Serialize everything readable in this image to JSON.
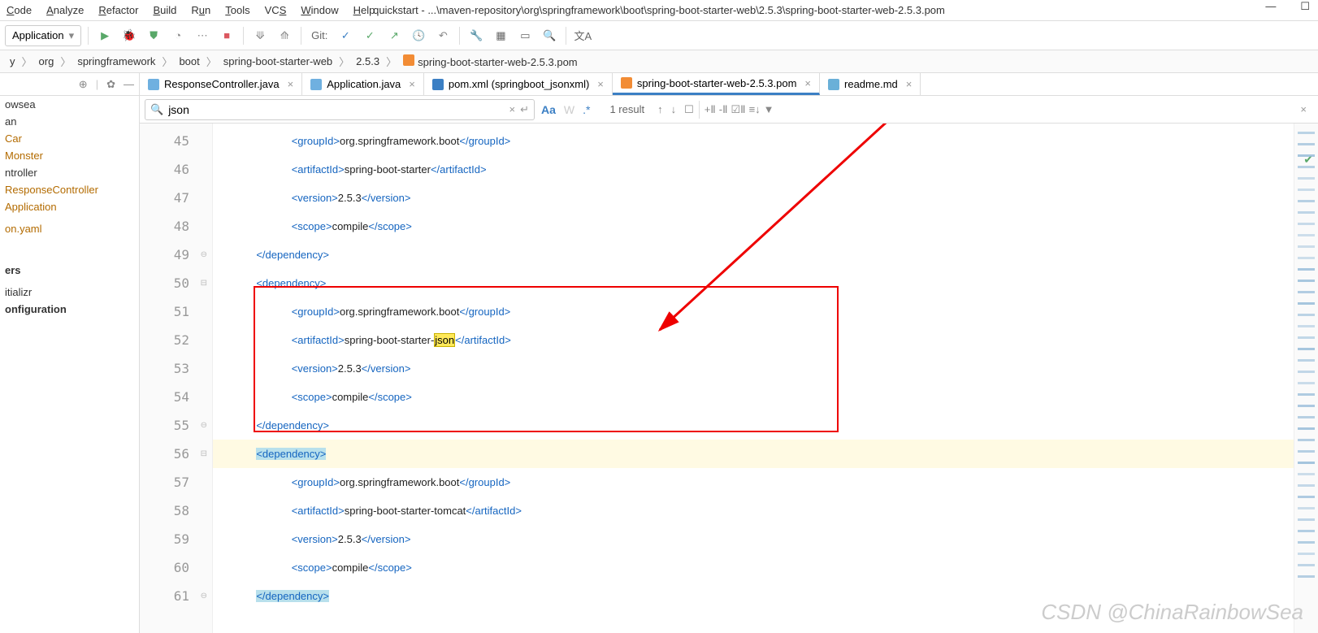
{
  "title": "quickstart - ...\\maven-repository\\org\\springframework\\boot\\spring-boot-starter-web\\2.5.3\\spring-boot-starter-web-2.5.3.pom",
  "menu": [
    "Code",
    "Analyze",
    "Refactor",
    "Build",
    "Run",
    "Tools",
    "VCS",
    "Window",
    "Help"
  ],
  "menu_u": [
    "C",
    "A",
    "R",
    "B",
    "R",
    "T",
    "V",
    "W",
    "H"
  ],
  "run_config": "Application",
  "git_label": "Git:",
  "breadcrumb": [
    "y",
    "org",
    "springframework",
    "boot",
    "spring-boot-starter-web",
    "2.5.3",
    "spring-boot-starter-web-2.5.3.pom"
  ],
  "sidebar": {
    "items": [
      {
        "label": "owsea",
        "cls": ""
      },
      {
        "label": "an",
        "cls": ""
      },
      {
        "label": "Car",
        "cls": "cls"
      },
      {
        "label": "Monster",
        "cls": "cls"
      },
      {
        "label": "ntroller",
        "cls": ""
      },
      {
        "label": "ResponseController",
        "cls": "cls"
      },
      {
        "label": "Application",
        "cls": "cls"
      },
      {
        "label": "",
        "cls": ""
      },
      {
        "label": "on.yaml",
        "cls": "yaml"
      },
      {
        "label": "",
        "cls": ""
      },
      {
        "label": "",
        "cls": ""
      },
      {
        "label": "",
        "cls": ""
      },
      {
        "label": "",
        "cls": ""
      },
      {
        "label": "",
        "cls": ""
      },
      {
        "label": "ers",
        "cls": "bold"
      },
      {
        "label": "",
        "cls": ""
      },
      {
        "label": "itializr",
        "cls": ""
      },
      {
        "label": "onfiguration",
        "cls": "bold"
      }
    ]
  },
  "tabs": [
    {
      "icon": "java",
      "label": "ResponseController.java",
      "active": false
    },
    {
      "icon": "java",
      "label": "Application.java",
      "active": false
    },
    {
      "icon": "maven",
      "label": "pom.xml (springboot_jsonxml)",
      "active": false
    },
    {
      "icon": "pom",
      "label": "spring-boot-starter-web-2.5.3.pom",
      "active": true
    },
    {
      "icon": "md",
      "label": "readme.md",
      "active": false
    }
  ],
  "find": {
    "query": "json",
    "results": "1 result"
  },
  "code": {
    "start": 45,
    "lines": [
      {
        "n": 45,
        "indent": 24,
        "parts": [
          [
            "tag",
            "<groupId>"
          ],
          [
            "txt",
            "org.springframework.boot"
          ],
          [
            "tag",
            "</groupId>"
          ]
        ]
      },
      {
        "n": 46,
        "indent": 24,
        "parts": [
          [
            "tag",
            "<artifactId>"
          ],
          [
            "txt",
            "spring-boot-starter"
          ],
          [
            "tag",
            "</artifactId>"
          ]
        ]
      },
      {
        "n": 47,
        "indent": 24,
        "parts": [
          [
            "tag",
            "<version>"
          ],
          [
            "txt",
            "2.5.3"
          ],
          [
            "tag",
            "</version>"
          ]
        ]
      },
      {
        "n": 48,
        "indent": 24,
        "parts": [
          [
            "tag",
            "<scope>"
          ],
          [
            "txt",
            "compile"
          ],
          [
            "tag",
            "</scope>"
          ]
        ]
      },
      {
        "n": 49,
        "indent": 12,
        "parts": [
          [
            "tag",
            "</dependency>"
          ]
        ]
      },
      {
        "n": 50,
        "indent": 12,
        "parts": [
          [
            "tag",
            "<dependency>"
          ]
        ]
      },
      {
        "n": 51,
        "indent": 24,
        "parts": [
          [
            "tag",
            "<groupId>"
          ],
          [
            "txt",
            "org.springframework.boot"
          ],
          [
            "tag",
            "</groupId>"
          ]
        ]
      },
      {
        "n": 52,
        "indent": 24,
        "parts": [
          [
            "tag",
            "<artifactId>"
          ],
          [
            "txt",
            "spring-boot-starter-"
          ],
          [
            "mark",
            "json"
          ],
          [
            "tag",
            "</artifactId>"
          ]
        ]
      },
      {
        "n": 53,
        "indent": 24,
        "parts": [
          [
            "tag",
            "<version>"
          ],
          [
            "txt",
            "2.5.3"
          ],
          [
            "tag",
            "</version>"
          ]
        ]
      },
      {
        "n": 54,
        "indent": 24,
        "parts": [
          [
            "tag",
            "<scope>"
          ],
          [
            "txt",
            "compile"
          ],
          [
            "tag",
            "</scope>"
          ]
        ]
      },
      {
        "n": 55,
        "indent": 12,
        "parts": [
          [
            "tag",
            "</dependency>"
          ]
        ]
      },
      {
        "n": 56,
        "indent": 12,
        "hl": true,
        "parts": [
          [
            "sel",
            "<dependency>"
          ]
        ]
      },
      {
        "n": 57,
        "indent": 24,
        "parts": [
          [
            "tag",
            "<groupId>"
          ],
          [
            "txt",
            "org.springframework.boot"
          ],
          [
            "tag",
            "</groupId>"
          ]
        ]
      },
      {
        "n": 58,
        "indent": 24,
        "parts": [
          [
            "tag",
            "<artifactId>"
          ],
          [
            "txt",
            "spring-boot-starter-tomcat"
          ],
          [
            "tag",
            "</artifactId>"
          ]
        ]
      },
      {
        "n": 59,
        "indent": 24,
        "parts": [
          [
            "tag",
            "<version>"
          ],
          [
            "txt",
            "2.5.3"
          ],
          [
            "tag",
            "</version>"
          ]
        ]
      },
      {
        "n": 60,
        "indent": 24,
        "parts": [
          [
            "tag",
            "<scope>"
          ],
          [
            "txt",
            "compile"
          ],
          [
            "tag",
            "</scope>"
          ]
        ]
      },
      {
        "n": 61,
        "indent": 12,
        "parts": [
          [
            "sel",
            "</dependency>"
          ]
        ]
      }
    ]
  },
  "watermark": "CSDN @ChinaRainbowSea"
}
